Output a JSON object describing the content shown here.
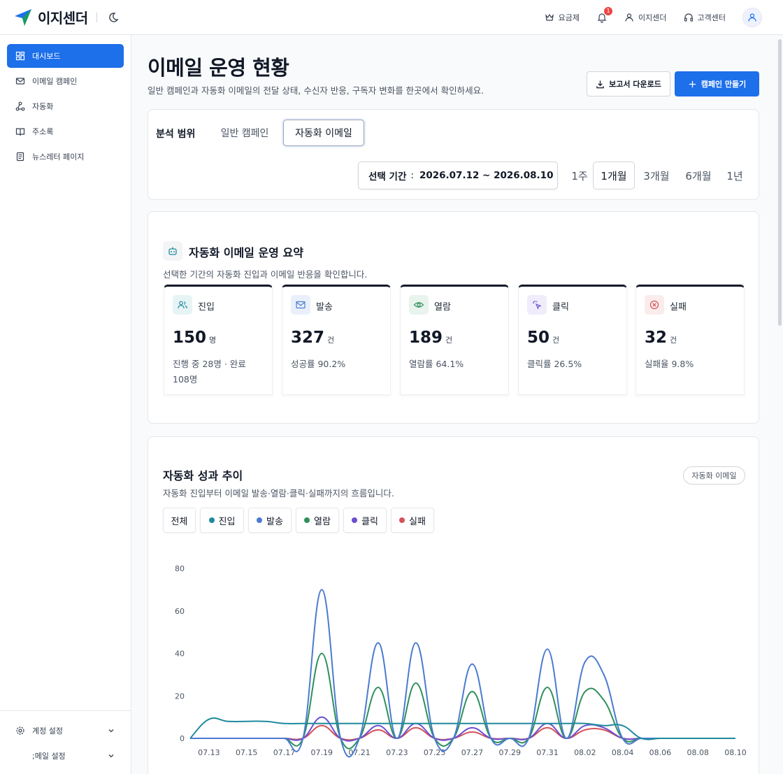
{
  "header": {
    "brand": "이지센더",
    "pricing": "요금제",
    "notification_count": "1",
    "account": "이지센더",
    "support": "고객센터"
  },
  "sidebar": {
    "items": [
      {
        "label": "대시보드",
        "icon": "dashboard-icon"
      },
      {
        "label": "이메일 캠페인",
        "icon": "mail-icon"
      },
      {
        "label": "자동화",
        "icon": "automation-icon"
      },
      {
        "label": "주소록",
        "icon": "book-icon"
      },
      {
        "label": "뉴스레터 페이지",
        "icon": "newsletter-icon"
      }
    ],
    "bottom": [
      {
        "label": "계정 설정",
        "icon": "gear-icon"
      },
      {
        "label": ";메일 설정",
        "icon": "mail-settings-icon"
      }
    ]
  },
  "page": {
    "title": "이메일 운영 현황",
    "subtitle": "일반 캠페인과 자동화 이메일의 전달 상태, 수신자 반응, 구독자 변화를 한곳에서 확인하세요.",
    "download_label": "보고서 다운로드",
    "create_label": "캠페인 만들기"
  },
  "scope": {
    "label": "분석 범위",
    "tabs": [
      "일반 캠페인",
      "자동화 이메일"
    ],
    "selected_tab": "자동화 이메일",
    "period_label": "선택 기간",
    "period_value": "2026.07.12 ~ 2026.08.10",
    "ranges": [
      "1주",
      "1개월",
      "3개월",
      "6개월",
      "1년"
    ],
    "selected_range": "1개월"
  },
  "summary": {
    "title": "자동화 이메일 운영 요약",
    "subtitle": "선택한 기간의 자동화 진입과 이메일 반응을 확인합니다.",
    "metrics": [
      {
        "label": "진입",
        "value": "150",
        "unit": "명",
        "desc": "진행 중 28명 · 완료 108명",
        "color": "#1f8a9e",
        "icon": "users-icon"
      },
      {
        "label": "발송",
        "value": "327",
        "unit": "건",
        "desc": "성공률 90.2%",
        "color": "#4a7bd0",
        "icon": "mail-icon"
      },
      {
        "label": "열람",
        "value": "189",
        "unit": "건",
        "desc": "열람률 64.1%",
        "color": "#2f8f5b",
        "icon": "eye-icon"
      },
      {
        "label": "클릭",
        "value": "50",
        "unit": "건",
        "desc": "클릭률 26.5%",
        "color": "#6c4fd1",
        "icon": "cursor-click-icon"
      },
      {
        "label": "실패",
        "value": "32",
        "unit": "건",
        "desc": "실패율 9.8%",
        "color": "#d4525a",
        "icon": "x-circle-icon"
      }
    ]
  },
  "trend": {
    "title": "자동화 성과 추이",
    "subtitle": "자동화 진입부터 이메일 발송·열람·클릭·실패까지의 흐름입니다.",
    "badge": "자동화 이메일",
    "filters": [
      {
        "label": "전체",
        "color": ""
      },
      {
        "label": "진입",
        "color": "#1f8a9e"
      },
      {
        "label": "발송",
        "color": "#4a7bd0"
      },
      {
        "label": "열람",
        "color": "#2f8f5b"
      },
      {
        "label": "클릭",
        "color": "#6c4fd1"
      },
      {
        "label": "실패",
        "color": "#d4525a"
      }
    ]
  },
  "chart_data": {
    "type": "line",
    "ylim": [
      0,
      80
    ],
    "y_ticks": [
      0,
      20,
      40,
      60,
      80
    ],
    "x_ticks": [
      "07.13",
      "07.15",
      "07.17",
      "07.19",
      "07.21",
      "07.23",
      "07.25",
      "07.27",
      "07.29",
      "07.31",
      "08.02",
      "08.04",
      "08.06",
      "08.08",
      "08.10"
    ],
    "x": [
      "07.12",
      "07.13",
      "07.14",
      "07.15",
      "07.16",
      "07.17",
      "07.18",
      "07.19",
      "07.20",
      "07.21",
      "07.22",
      "07.23",
      "07.24",
      "07.25",
      "07.26",
      "07.27",
      "07.28",
      "07.29",
      "07.30",
      "07.31",
      "08.01",
      "08.02",
      "08.03",
      "08.04",
      "08.05",
      "08.06",
      "08.07",
      "08.08",
      "08.09",
      "08.10"
    ],
    "series": [
      {
        "name": "진입",
        "color": "#1f8a9e",
        "values": [
          0,
          9,
          8,
          8,
          8,
          7,
          7,
          7,
          7,
          7,
          7,
          7,
          7,
          7,
          7,
          7,
          7,
          7,
          7,
          7,
          7,
          7,
          6,
          6,
          0,
          0,
          0,
          0,
          0,
          0
        ]
      },
      {
        "name": "발송",
        "color": "#4a7bd0",
        "values": [
          0,
          0,
          0,
          0,
          0,
          0,
          0,
          70,
          0,
          0,
          45,
          0,
          45,
          0,
          0,
          35,
          0,
          0,
          0,
          42,
          0,
          36,
          30,
          0,
          0,
          0,
          0,
          0,
          0,
          0
        ]
      },
      {
        "name": "열람",
        "color": "#2f8f5b",
        "values": [
          0,
          0,
          0,
          0,
          0,
          0,
          0,
          40,
          0,
          0,
          24,
          0,
          26,
          0,
          0,
          22,
          0,
          0,
          0,
          24,
          0,
          22,
          18,
          0,
          0,
          0,
          0,
          0,
          0,
          0
        ]
      },
      {
        "name": "클릭",
        "color": "#6c4fd1",
        "values": [
          0,
          0,
          0,
          0,
          0,
          0,
          0,
          10,
          0,
          0,
          6,
          0,
          7,
          0,
          0,
          5,
          0,
          0,
          0,
          7,
          0,
          6,
          5,
          0,
          0,
          0,
          0,
          0,
          0,
          0
        ]
      },
      {
        "name": "실패",
        "color": "#d4525a",
        "values": [
          0,
          0,
          0,
          0,
          0,
          0,
          0,
          6,
          0,
          0,
          4,
          0,
          5,
          0,
          0,
          3,
          0,
          0,
          0,
          5,
          0,
          4,
          4,
          0,
          0,
          0,
          0,
          0,
          0,
          0
        ]
      }
    ]
  }
}
